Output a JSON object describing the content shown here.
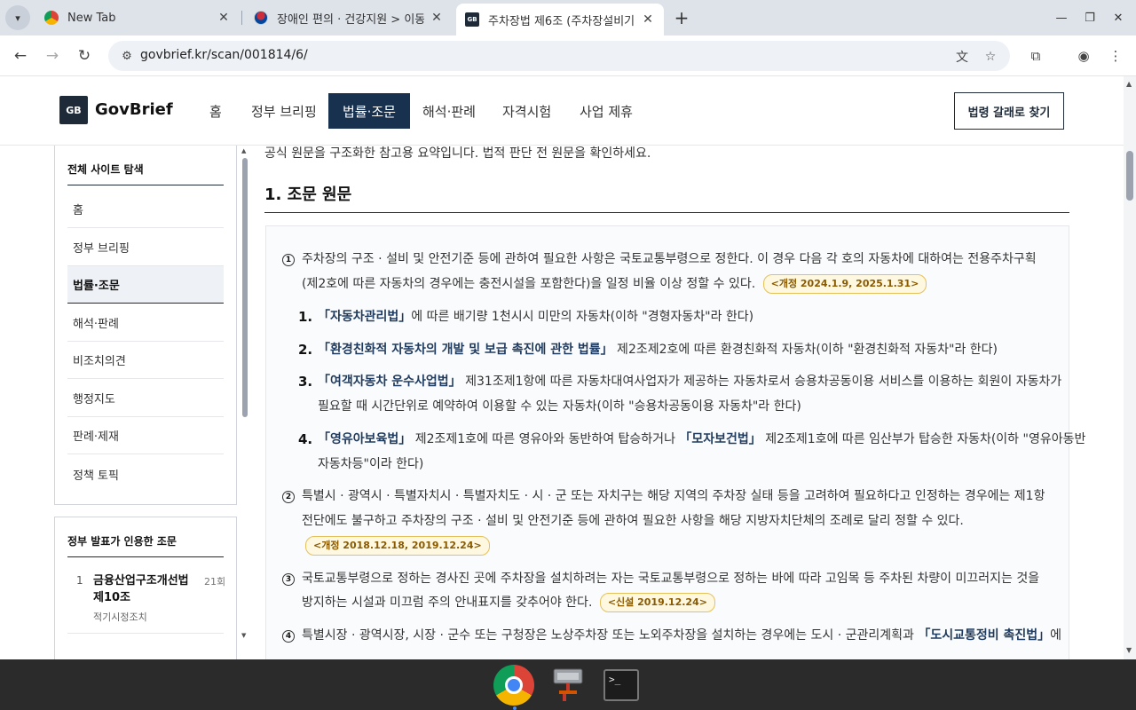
{
  "browser": {
    "tabs": [
      {
        "title": "New Tab",
        "favicon": "chrome-favicon-icon"
      },
      {
        "title": "장애인 편의 · 건강지원 > 이동",
        "favicon": "korea-flag-icon"
      },
      {
        "title": "주차장법 제6조 (주차장설비기",
        "favicon": "govbrief-favicon-icon",
        "favicon_text": "GB"
      }
    ],
    "url": "govbrief.kr/scan/001814/6/"
  },
  "site": {
    "logo_mark": "GB",
    "logo_name": "GovBrief",
    "nav": [
      "홈",
      "정부 브리핑",
      "법률·조문",
      "해석·판례",
      "자격시험",
      "사업 제휴"
    ],
    "active_nav": "법률·조문",
    "header_button": "법령 갈래로 찾기"
  },
  "sidebar": {
    "title": "전체 사이트 탐색",
    "items": [
      "홈",
      "정부 브리핑",
      "법률·조문",
      "해석·판례",
      "비조치의견",
      "행정지도",
      "판례·제재",
      "정책 토픽"
    ],
    "active": "법률·조문"
  },
  "cited": {
    "title": "정부 발표가 인용한 조문",
    "items": [
      {
        "rank": "1",
        "title": "금융산업구조개선법 제10조",
        "count": "21회",
        "sub": "적기시정조치"
      }
    ]
  },
  "main": {
    "notice": "공식 원문을 구조화한 참고용 요약입니다. 법적 판단 전 원문을 확인하세요.",
    "section_title": "1. 조문 원문",
    "p1": {
      "num": "1",
      "line1": "주차장의 구조 · 설비 및 안전기준 등에 관하여 필요한 사항은 국토교통부령으로 정한다. 이 경우 다음 각 호의 자동차에 대하여는 전용주차구획",
      "line2": "(제2호에 따른 자동차의 경우에는 충전시설을 포함한다)을 일정 비율 이상 정할 수 있다.",
      "amend": "<개정 2024.1.9, 2025.1.31>"
    },
    "sub1": {
      "num": "1.",
      "law": "「자동차관리법」",
      "text": "에 따른 배기량 1천시시 미만의 자동차(이하 \"경형자동차\"라 한다)"
    },
    "sub2": {
      "num": "2.",
      "law": "「환경친화적 자동차의 개발 및 보급 촉진에 관한 법률」",
      "text": " 제2조제2호에 따른 환경친화적 자동차(이하 \"환경친화적 자동차\"라 한다)"
    },
    "sub3": {
      "num": "3.",
      "law": "「여객자동차 운수사업법」",
      "text": " 제31조제1항에 따른 자동차대여사업자가 제공하는 자동차로서 승용차공동이용 서비스를 이용하는 회원이 자동차가",
      "line2": "필요할 때 시간단위로 예약하여 이용할 수 있는 자동차(이하 \"승용차공동이용 자동차\"라 한다)"
    },
    "sub4": {
      "num": "4.",
      "law": "「영유아보육법」",
      "text": " 제2조제1호에 따른 영유아와 동반하여 탑승하거나 ",
      "law2": "「모자보건법」",
      "text2": " 제2조제1호에 따른 임산부가 탑승한 자동차(이하 \"영유아동반",
      "line2": "자동차등\"이라 한다)"
    },
    "p2": {
      "num": "2",
      "line1": "특별시 · 광역시 · 특별자치시 · 특별자치도 · 시 · 군 또는 자치구는 해당 지역의 주차장 실태 등을 고려하여 필요하다고 인정하는 경우에는 제1항",
      "line2": "전단에도 불구하고 주차장의 구조 · 설비 및 안전기준 등에 관하여 필요한 사항을 해당 지방자치단체의 조례로 달리 정할 수 있다.",
      "amend": "<개정 2018.12.18, 2019.12.24>"
    },
    "p3": {
      "num": "3",
      "line1": "국토교통부령으로 정하는 경사진 곳에 주차장을 설치하려는 자는 국토교통부령으로 정하는 바에 따라 고임목 등 주차된 차량이 미끄러지는 것을",
      "line2": "방지하는 시설과 미끄럼 주의 안내표지를 갖추어야 한다.",
      "amend": "<신설 2019.12.24>"
    },
    "p4": {
      "num": "4",
      "line1a": "특별시장 · 광역시장, 시장 · 군수 또는 구청장은 노상주차장 또는 노외주차장을 설치하는 경우에는 도시 · 군관리계획과 ",
      "law": "「도시교통정비 촉진법」",
      "line1b": "에"
    }
  },
  "colors": {
    "nav_active": "#18314f",
    "accent": "#1e3a5f",
    "amend_bg": "#fff8e1"
  }
}
